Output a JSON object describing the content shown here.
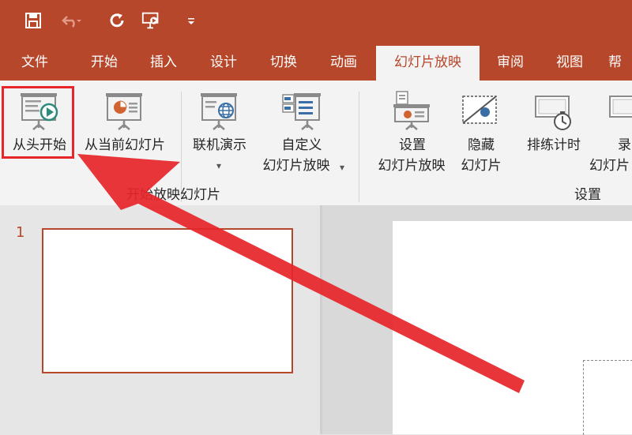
{
  "app": {
    "accent_color": "#b7472a"
  },
  "quick_access": {
    "save_icon": "save-icon",
    "undo_icon": "undo-icon",
    "redo_icon": "redo-icon",
    "present_icon": "present-from-beginning-icon",
    "customize_icon": "customize-quick-access-icon"
  },
  "tabs": [
    {
      "label": "文件"
    },
    {
      "label": "开始"
    },
    {
      "label": "插入"
    },
    {
      "label": "设计"
    },
    {
      "label": "切换"
    },
    {
      "label": "动画"
    },
    {
      "label": "幻灯片放映",
      "active": true
    },
    {
      "label": "审阅"
    },
    {
      "label": "视图"
    },
    {
      "label": "帮"
    }
  ],
  "ribbon": {
    "start_group": {
      "from_beginning": "从头开始",
      "from_current": "从当前幻灯片",
      "online_line1": "联机演示",
      "online_arrow": "▾",
      "custom_line1": "自定义",
      "custom_line2": "幻灯片放映",
      "custom_arrow": "▾",
      "label": "开始放映幻灯片"
    },
    "setup_group": {
      "setup_line1": "设置",
      "setup_line2": "幻灯片放映",
      "hide_line1": "隐藏",
      "hide_line2": "幻灯片",
      "rehearse": "排练计时",
      "record_line1": "录",
      "record_line2": "幻灯片",
      "label": "设置"
    }
  },
  "slides_pane": {
    "slide_number": "1"
  },
  "annotation": {
    "arrow_color": "#e6262a"
  }
}
